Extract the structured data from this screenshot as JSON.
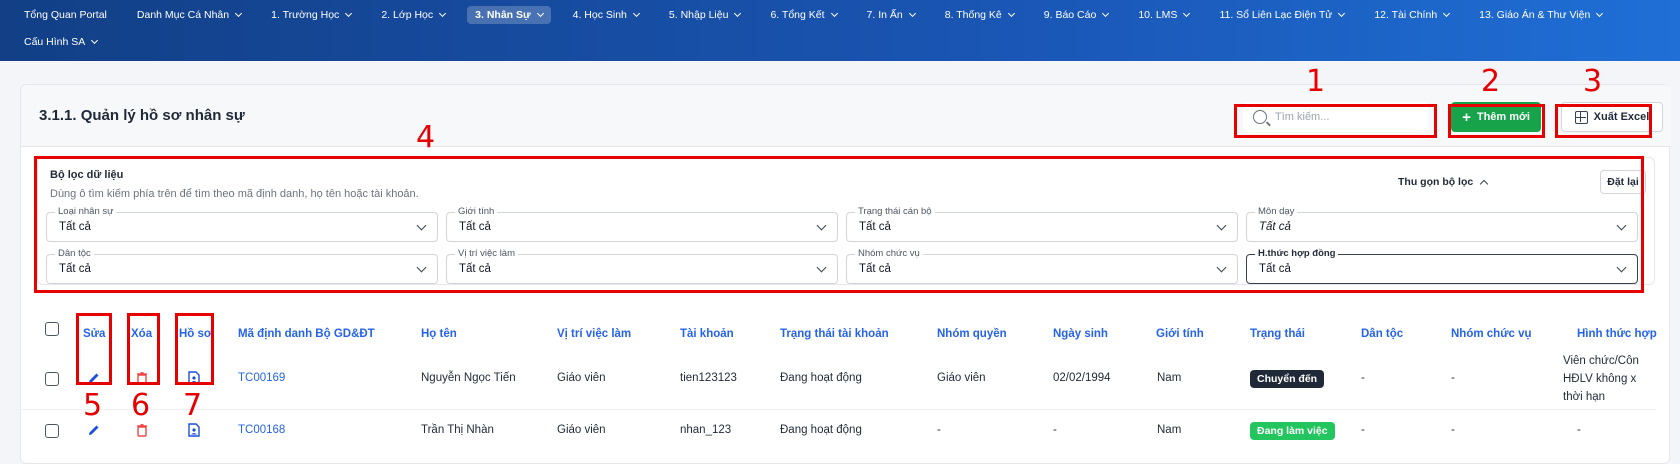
{
  "nav": {
    "items": [
      {
        "label": "Tổng Quan Portal"
      },
      {
        "label": "Danh Mục Cá Nhân"
      },
      {
        "label": "1. Trường Học"
      },
      {
        "label": "2. Lớp Học"
      },
      {
        "label": "3. Nhân Sự"
      },
      {
        "label": "4. Học Sinh"
      },
      {
        "label": "5. Nhập Liệu"
      },
      {
        "label": "6. Tổng Kết"
      },
      {
        "label": "7. In Ấn"
      },
      {
        "label": "8. Thống Kê"
      },
      {
        "label": "9. Báo Cáo"
      },
      {
        "label": "10. LMS"
      },
      {
        "label": "11. Sổ Liên Lạc Điện Tử"
      },
      {
        "label": "12. Tài Chính"
      },
      {
        "label": "13. Giáo Án & Thư Viện"
      },
      {
        "label": "Cấu Hình SA"
      }
    ],
    "active_index": 4
  },
  "page": {
    "title": "3.1.1. Quản lý hồ sơ nhân sự"
  },
  "search": {
    "placeholder": "Tìm kiếm..."
  },
  "toolbar": {
    "add_label": "Thêm mới",
    "excel_label": "Xuất Excel"
  },
  "filter": {
    "title": "Bộ lọc dữ liệu",
    "hint": "Dùng ô tìm kiếm phía trên để tìm theo mã định danh, họ tên hoặc tài khoản.",
    "collapse_label": "Thu gọn bộ lọc",
    "reset_label": "Đặt lại",
    "fields": [
      {
        "label": "Loại nhân sự",
        "value": "Tất cả"
      },
      {
        "label": "Giới tính",
        "value": "Tất cả"
      },
      {
        "label": "Trạng thái cán bộ",
        "value": "Tất cả"
      },
      {
        "label": "Môn dạy",
        "value": "Tất cả"
      },
      {
        "label": "Dân tộc",
        "value": "Tất cả"
      },
      {
        "label": "Vị trí việc làm",
        "value": "Tất cả"
      },
      {
        "label": "Nhóm chức vụ",
        "value": "Tất cả"
      },
      {
        "label": "H.thức hợp đồng",
        "value": "Tất cả"
      }
    ]
  },
  "table": {
    "columns": [
      "Sửa",
      "Xóa",
      "Hồ sơ",
      "Mã định danh Bộ GD&ĐT",
      "Họ tên",
      "Vị trí việc làm",
      "Tài khoản",
      "Trạng thái tài khoản",
      "Nhóm quyền",
      "Ngày sinh",
      "Giới tính",
      "Trạng thái",
      "Dân tộc",
      "Nhóm chức vụ",
      "Hình thức hợp"
    ],
    "rows": [
      {
        "code": "TC00169",
        "name": "Nguyễn Ngọc Tiến",
        "position": "Giáo viên",
        "account": "tien123123",
        "account_status": "Đang hoạt động",
        "role": "Giáo viên",
        "dob": "02/02/1994",
        "gender": "Nam",
        "status": "Chuyển đến",
        "ethnicity": "-",
        "group": "-",
        "contract": [
          "Viên chức/Côn",
          "HĐLV không x",
          "thời hạn"
        ]
      },
      {
        "code": "TC00168",
        "name": "Trần Thị Nhàn",
        "position": "Giáo viên",
        "account": "nhan_123",
        "account_status": "Đang hoạt động",
        "role": "-",
        "dob": "-",
        "gender": "Nam",
        "status": "Đang làm việc",
        "ethnicity": "-",
        "group": "-",
        "contract": [
          "-"
        ]
      }
    ]
  },
  "annotations": [
    "1",
    "2",
    "3",
    "4",
    "5",
    "6",
    "7"
  ],
  "colors": {
    "nav_bg": "#1a56b5",
    "add_button": "#16a34a",
    "link": "#2563eb",
    "annotation": "#e60000"
  }
}
